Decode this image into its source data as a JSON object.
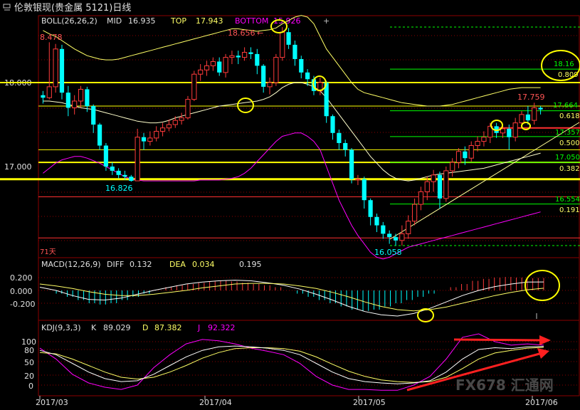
{
  "header": {
    "title": "伦敦银现(贵金属 5121)日线"
  },
  "boll": {
    "label": "BOLL(26,26,2)",
    "mid_label": "MID",
    "mid_value": "16.935",
    "top_label": "TOP",
    "top_value": "17.943",
    "bottom_label": "BOTTOM",
    "bottom_value": "15.926"
  },
  "price_axis": {
    "ticks": [
      "18.000",
      "17.000"
    ]
  },
  "annotations": {
    "high_left": "8.478",
    "high_mid": "18.656",
    "low_left": "16.826",
    "low_mid": "16.058",
    "recent_high": "17.759",
    "days_label": "71天"
  },
  "fib": [
    {
      "price": "18.16",
      "ratio": "0.809"
    },
    {
      "price": "17.664",
      "ratio": "0.618"
    },
    {
      "price": "17.357",
      "ratio": "0.500"
    },
    {
      "price": "17.050",
      "ratio": "0.382"
    },
    {
      "price": "16.554",
      "ratio": "0.191"
    }
  ],
  "macd": {
    "label": "MACD(12,26,9)",
    "diff_label": "DIFF",
    "diff_value": "0.132",
    "dea_label": "DEA",
    "dea_value": "0.034",
    "macd_value": "0.195",
    "ticks": [
      "0.200",
      "0.000",
      "-0.200"
    ]
  },
  "kdj": {
    "label": "KDJ(9,3,3)",
    "k_label": "K",
    "k_value": "89.029",
    "d_label": "D",
    "d_value": "87.382",
    "j_label": "J",
    "j_value": "92.322",
    "ticks": [
      "100",
      "80",
      "50",
      "20",
      "0"
    ]
  },
  "x_axis": {
    "labels": [
      "2017/03",
      "2017/04",
      "2017/05",
      "2017/06"
    ]
  },
  "watermark": "FX678 汇通网",
  "colors": {
    "up": "#ff3b3b",
    "down": "#00ffff",
    "grid": "#8b0000",
    "mid": "#ffff66",
    "band": "#ff00ff",
    "fib": "#00ff00",
    "key_level": "#ffff00"
  },
  "chart_data": {
    "type": "candlestick",
    "title": "伦敦银现(贵金属 5121)日线",
    "ylim": [
      15.9,
      18.75
    ],
    "candles": [
      [
        17.85,
        17.82,
        17.9,
        17.75
      ],
      [
        17.82,
        17.95,
        18.48,
        17.8
      ],
      [
        17.95,
        18.4,
        18.46,
        17.88
      ],
      [
        18.4,
        17.88,
        18.45,
        17.8
      ],
      [
        17.88,
        17.7,
        17.96,
        17.6
      ],
      [
        17.7,
        17.78,
        17.85,
        17.62
      ],
      [
        17.78,
        17.92,
        17.96,
        17.7
      ],
      [
        17.92,
        17.72,
        17.95,
        17.65
      ],
      [
        17.72,
        17.5,
        17.74,
        17.4
      ],
      [
        17.5,
        17.25,
        17.52,
        17.2
      ],
      [
        17.25,
        17.0,
        17.28,
        16.95
      ],
      [
        17.0,
        16.95,
        17.05,
        16.9
      ],
      [
        16.95,
        16.9,
        16.98,
        16.86
      ],
      [
        16.9,
        16.88,
        16.95,
        16.84
      ],
      [
        16.88,
        16.83,
        16.9,
        16.82
      ],
      [
        16.83,
        17.35,
        17.45,
        16.83
      ],
      [
        17.35,
        17.3,
        17.4,
        17.2
      ],
      [
        17.3,
        17.34,
        17.42,
        17.25
      ],
      [
        17.34,
        17.42,
        17.48,
        17.3
      ],
      [
        17.42,
        17.46,
        17.52,
        17.36
      ],
      [
        17.46,
        17.5,
        17.56,
        17.42
      ],
      [
        17.5,
        17.55,
        17.6,
        17.46
      ],
      [
        17.55,
        17.58,
        17.64,
        17.5
      ],
      [
        17.58,
        17.8,
        17.84,
        17.56
      ],
      [
        17.8,
        18.1,
        18.14,
        17.78
      ],
      [
        18.1,
        18.15,
        18.22,
        18.02
      ],
      [
        18.15,
        18.2,
        18.26,
        18.08
      ],
      [
        18.2,
        18.25,
        18.3,
        18.14
      ],
      [
        18.25,
        18.12,
        18.3,
        18.08
      ],
      [
        18.12,
        18.3,
        18.34,
        18.06
      ],
      [
        18.3,
        18.32,
        18.38,
        18.22
      ],
      [
        18.32,
        18.3,
        18.38,
        18.22
      ],
      [
        18.3,
        18.36,
        18.42,
        18.26
      ],
      [
        18.36,
        18.34,
        18.42,
        18.28
      ],
      [
        18.34,
        18.2,
        18.4,
        18.1
      ],
      [
        18.2,
        17.95,
        18.22,
        17.88
      ],
      [
        17.95,
        18.0,
        18.06,
        17.86
      ],
      [
        18.0,
        18.3,
        18.34,
        17.96
      ],
      [
        18.3,
        18.6,
        18.66,
        18.26
      ],
      [
        18.6,
        18.45,
        18.65,
        18.4
      ],
      [
        18.45,
        18.28,
        18.5,
        18.2
      ],
      [
        18.28,
        18.12,
        18.32,
        18.05
      ],
      [
        18.12,
        18.04,
        18.16,
        17.96
      ],
      [
        18.04,
        17.9,
        18.08,
        17.85
      ],
      [
        17.9,
        18.0,
        18.06,
        17.85
      ],
      [
        18.0,
        17.6,
        18.02,
        17.52
      ],
      [
        17.6,
        17.4,
        17.62,
        17.32
      ],
      [
        17.4,
        17.28,
        17.44,
        17.2
      ],
      [
        17.28,
        17.2,
        17.32,
        17.12
      ],
      [
        17.2,
        16.85,
        17.22,
        16.8
      ],
      [
        16.85,
        16.85,
        16.9,
        16.78
      ],
      [
        16.85,
        16.6,
        16.88,
        16.5
      ],
      [
        16.6,
        16.4,
        16.62,
        16.3
      ],
      [
        16.4,
        16.3,
        16.44,
        16.22
      ],
      [
        16.3,
        16.2,
        16.34,
        16.14
      ],
      [
        16.2,
        16.16,
        16.24,
        16.08
      ],
      [
        16.16,
        16.12,
        16.2,
        16.06
      ],
      [
        16.12,
        16.2,
        16.3,
        16.06
      ],
      [
        16.2,
        16.35,
        16.42,
        16.14
      ],
      [
        16.35,
        16.55,
        16.62,
        16.3
      ],
      [
        16.55,
        16.7,
        16.76,
        16.48
      ],
      [
        16.7,
        16.82,
        16.88,
        16.6
      ],
      [
        16.82,
        16.9,
        16.96,
        16.7
      ],
      [
        16.9,
        16.62,
        16.94,
        16.5
      ],
      [
        16.62,
        16.95,
        17.0,
        16.58
      ],
      [
        16.95,
        17.05,
        17.1,
        16.88
      ],
      [
        17.05,
        17.18,
        17.22,
        16.98
      ],
      [
        17.18,
        17.1,
        17.24,
        17.02
      ],
      [
        17.1,
        17.25,
        17.3,
        17.06
      ],
      [
        17.25,
        17.3,
        17.36,
        17.18
      ],
      [
        17.3,
        17.35,
        17.42,
        17.24
      ],
      [
        17.35,
        17.48,
        17.52,
        17.28
      ],
      [
        17.48,
        17.4,
        17.52,
        17.34
      ],
      [
        17.4,
        17.45,
        17.5,
        17.34
      ],
      [
        17.45,
        17.35,
        17.5,
        17.2
      ],
      [
        17.35,
        17.52,
        17.58,
        17.3
      ],
      [
        17.52,
        17.62,
        17.66,
        17.46
      ],
      [
        17.62,
        17.55,
        17.72,
        17.5
      ],
      [
        17.55,
        17.7,
        17.76,
        17.5
      ],
      [
        17.7,
        17.68,
        17.72,
        17.62
      ]
    ],
    "boll_mid": [
      17.78,
      17.78,
      17.77,
      17.76,
      17.74,
      17.72,
      17.7,
      17.69,
      17.68,
      17.66,
      17.64,
      17.62,
      17.6,
      17.58,
      17.56,
      17.54,
      17.53,
      17.52,
      17.52,
      17.53,
      17.55,
      17.58,
      17.6,
      17.62,
      17.64,
      17.66,
      17.68,
      17.7,
      17.72,
      17.73,
      17.74,
      17.75,
      17.76,
      17.77,
      17.78,
      17.8,
      17.83,
      17.88,
      17.94,
      17.98,
      18.0,
      18.0,
      17.98,
      17.95,
      17.9,
      17.82,
      17.72,
      17.62,
      17.52,
      17.42,
      17.32,
      17.22,
      17.12,
      17.04,
      16.96,
      16.9,
      16.86,
      16.84,
      16.83,
      16.84,
      16.86,
      16.88,
      16.9,
      16.91,
      16.92,
      16.93,
      16.94,
      16.95,
      16.96,
      16.97,
      16.98,
      17.0,
      17.02,
      17.04,
      17.06,
      17.08,
      17.1,
      17.12,
      17.14,
      17.16
    ],
    "boll_top": [
      18.62,
      18.58,
      18.55,
      18.5,
      18.45,
      18.4,
      18.36,
      18.32,
      18.3,
      18.28,
      18.27,
      18.27,
      18.28,
      18.3,
      18.32,
      18.34,
      18.36,
      18.38,
      18.4,
      18.42,
      18.44,
      18.46,
      18.48,
      18.5,
      18.52,
      18.54,
      18.56,
      18.58,
      18.6,
      18.62,
      18.64,
      18.64,
      18.63,
      18.62,
      18.61,
      18.62,
      18.63,
      18.65,
      18.7,
      18.74,
      18.78,
      18.8,
      18.78,
      18.7,
      18.55,
      18.4,
      18.3,
      18.2,
      18.1,
      18.0,
      17.92,
      17.88,
      17.86,
      17.84,
      17.82,
      17.8,
      17.78,
      17.76,
      17.75,
      17.74,
      17.73,
      17.72,
      17.72,
      17.72,
      17.73,
      17.74,
      17.76,
      17.78,
      17.8,
      17.82,
      17.84,
      17.86,
      17.88,
      17.9,
      17.92,
      17.93,
      17.94,
      17.94,
      17.94,
      17.94
    ],
    "boll_bottom": [
      16.92,
      16.98,
      17.04,
      17.08,
      17.1,
      17.12,
      17.12,
      17.1,
      17.07,
      17.04,
      17.0,
      16.96,
      16.92,
      16.88,
      16.85,
      16.84,
      16.83,
      16.83,
      16.83,
      16.83,
      16.83,
      16.83,
      16.83,
      16.83,
      16.83,
      16.84,
      16.84,
      16.84,
      16.84,
      16.85,
      16.86,
      16.88,
      16.92,
      16.98,
      17.06,
      17.14,
      17.22,
      17.3,
      17.36,
      17.38,
      17.4,
      17.4,
      17.36,
      17.3,
      17.2,
      17.0,
      16.8,
      16.6,
      16.45,
      16.3,
      16.18,
      16.08,
      15.98,
      15.92,
      15.9,
      15.92,
      15.96,
      16.0,
      16.04,
      16.06,
      16.08,
      16.1,
      16.12,
      16.14,
      16.16,
      16.18,
      16.2,
      16.22,
      16.24,
      16.26,
      16.28,
      16.3,
      16.32,
      16.34,
      16.36,
      16.38,
      16.4,
      16.42,
      16.44,
      16.46
    ],
    "fib_levels": [
      18.16,
      17.664,
      17.357,
      17.05,
      16.554
    ],
    "key_levels": [
      18.0,
      17.72,
      17.2,
      17.05,
      16.85
    ],
    "macd_hist_sample": [
      0.0,
      -0.05,
      -0.1,
      -0.15,
      -0.2,
      -0.22,
      -0.2,
      -0.15,
      -0.1,
      -0.05,
      0.0,
      0.05,
      0.08,
      0.1,
      0.12,
      0.14,
      0.15,
      0.14,
      0.12,
      0.1,
      0.08,
      0.05,
      0.0,
      -0.05,
      -0.1,
      -0.15,
      -0.2,
      -0.25,
      -0.3,
      -0.32,
      -0.3,
      -0.25,
      -0.2,
      -0.15,
      -0.1,
      -0.05,
      0.0,
      0.05,
      0.1,
      0.15,
      0.18,
      0.2,
      0.21,
      0.2,
      0.19,
      0.195
    ]
  }
}
